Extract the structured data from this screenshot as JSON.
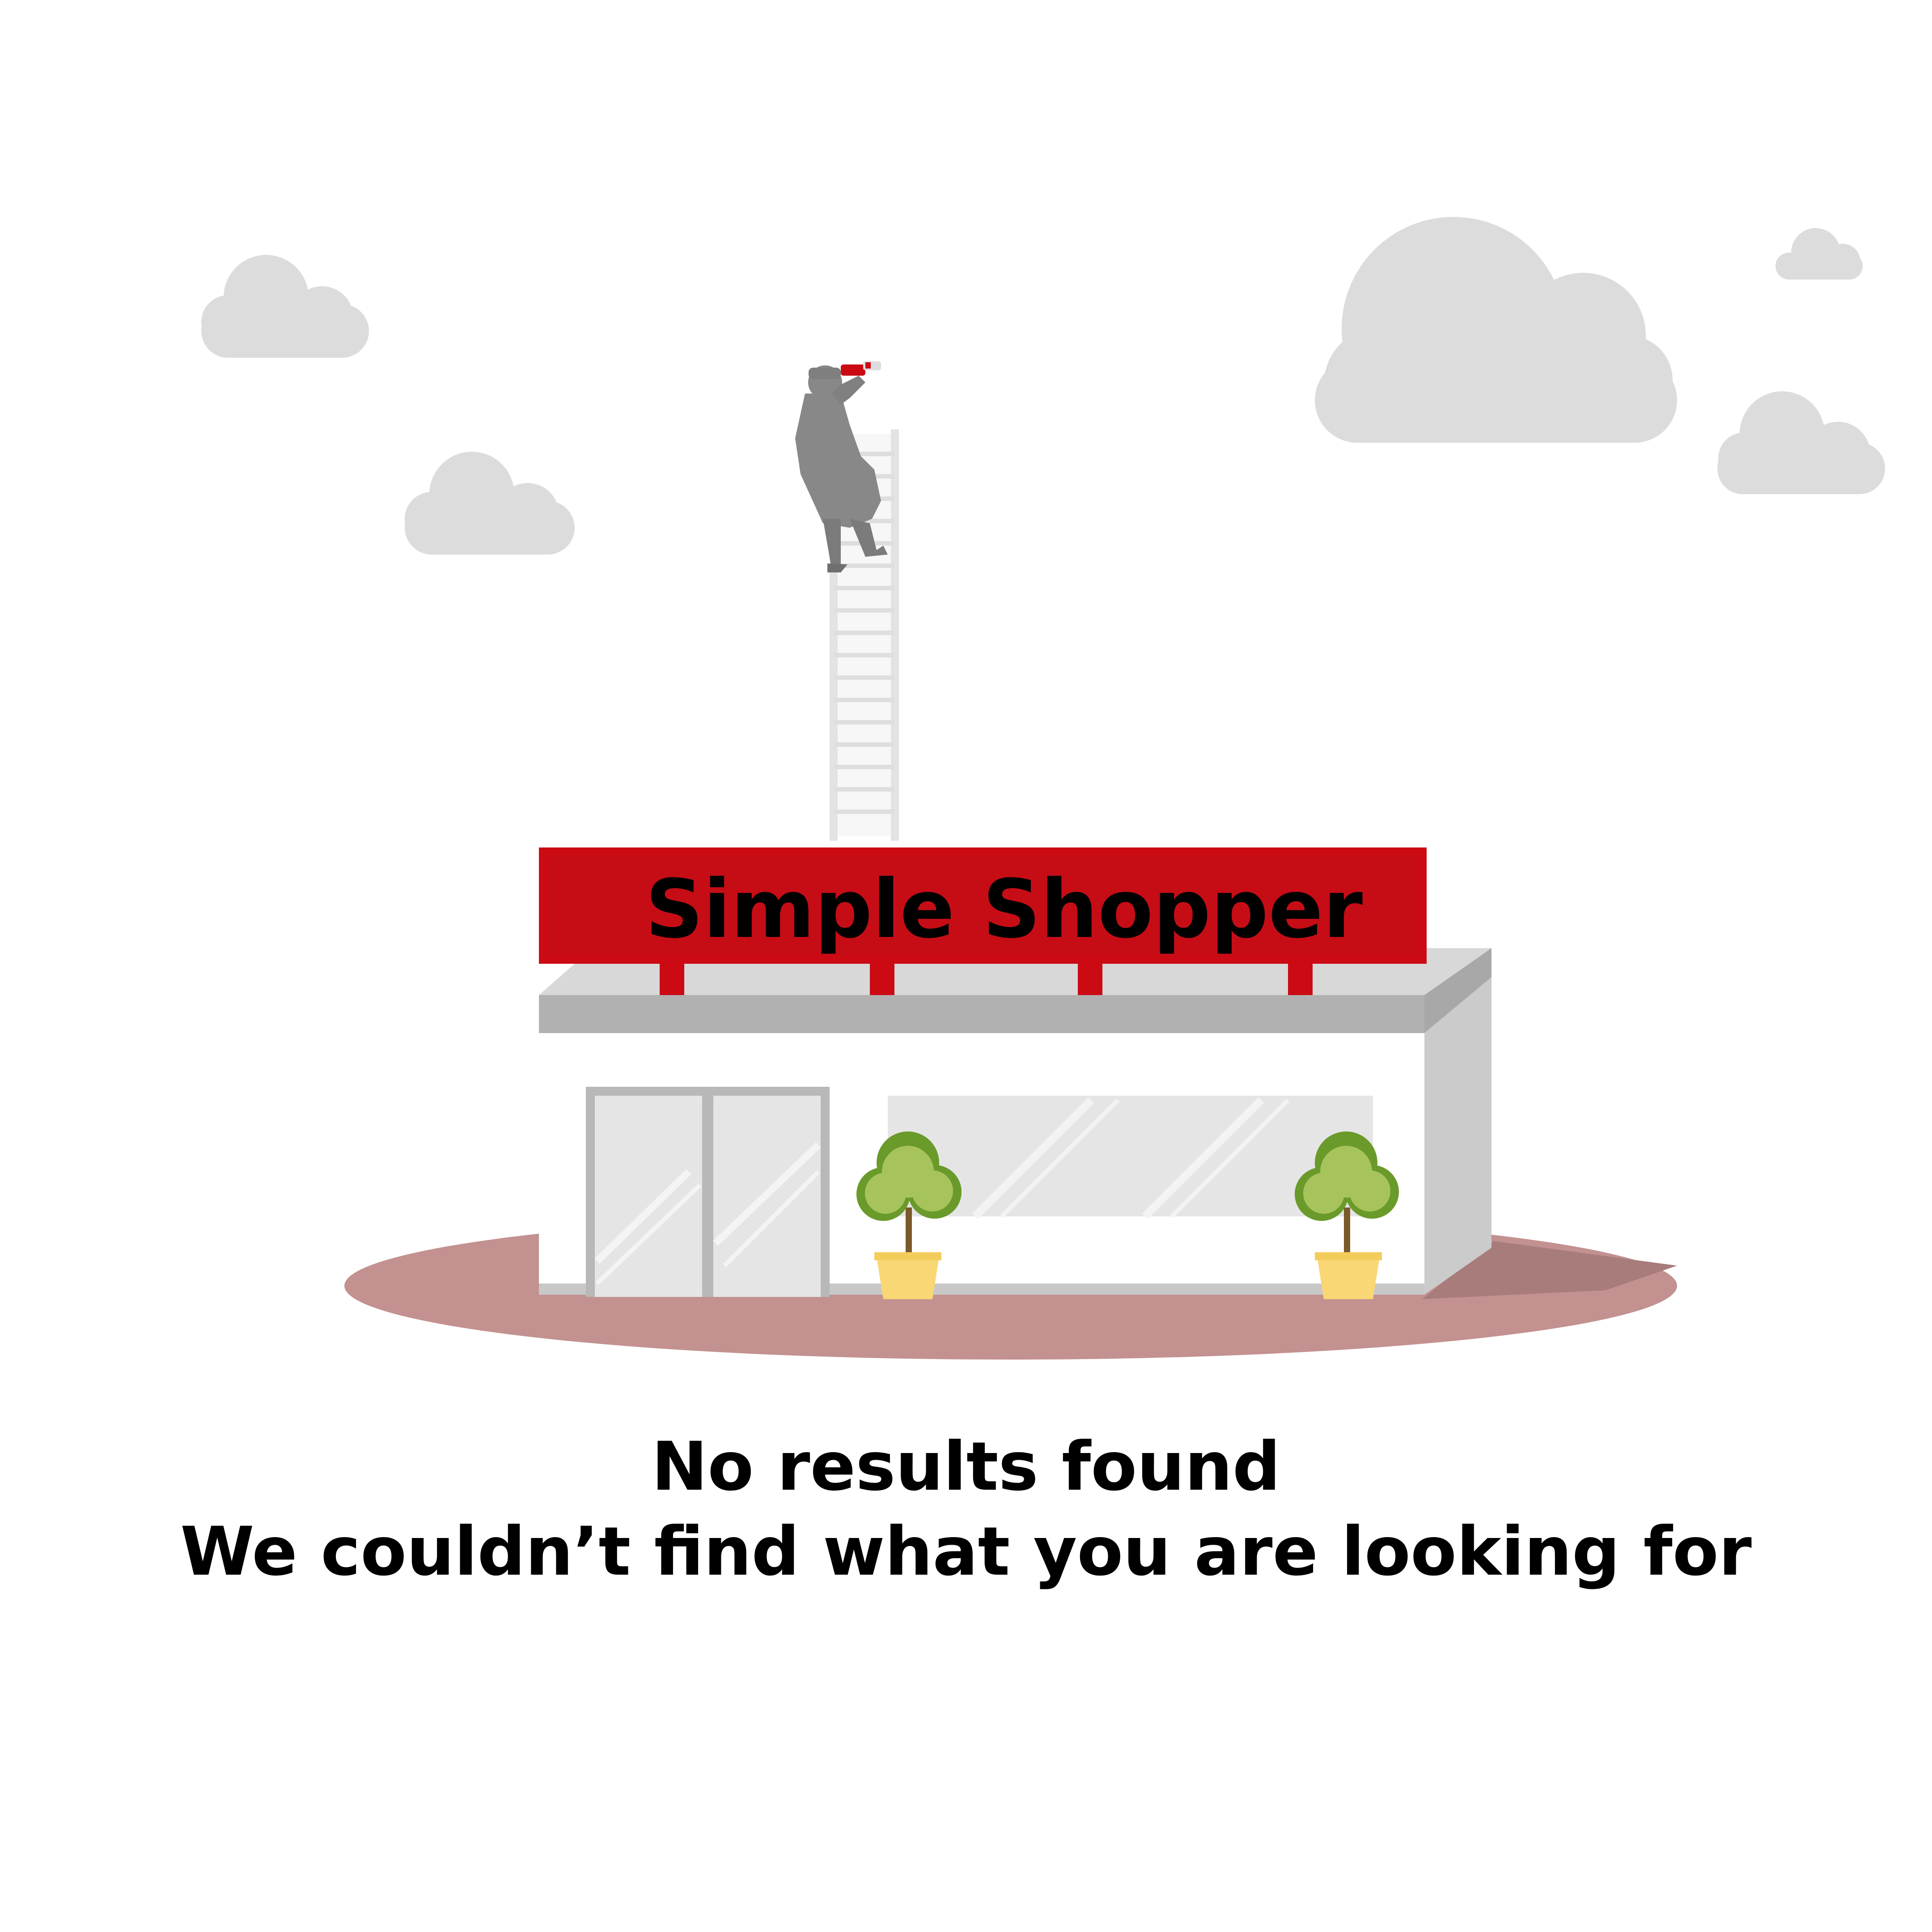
{
  "store": {
    "sign_text": "Simple Shopper"
  },
  "empty_state": {
    "title": "No results found",
    "subtitle": "We couldn’t find what you are looking for"
  },
  "icons": {
    "clouds": "cloud-icon",
    "person": "person-with-binoculars-icon",
    "ladder": "ladder-icon",
    "storefront": "storefront-icon",
    "plants": "potted-tree-icon"
  },
  "colors": {
    "sign_red": "#cc0a14",
    "cloud_gray": "#dcdcdc",
    "ground": "#c29190",
    "building_white": "#ffffff",
    "roof_gray": "#b1b1b1",
    "side_gray": "#cbcbcb",
    "glass": "#e5e5e5",
    "leaf": "#a7c35c",
    "leaf_dark": "#6a9a2a",
    "pot": "#f8d774",
    "person": "#888888",
    "text": "#000000"
  }
}
